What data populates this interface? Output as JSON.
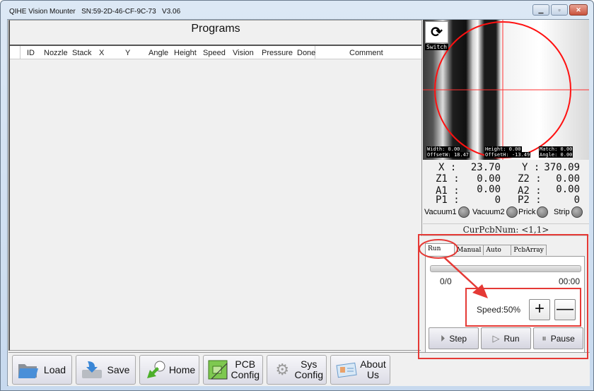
{
  "window": {
    "title": "QIHE Vision Mounter",
    "serial": "SN:59-2D-46-CF-9C-73",
    "version": "V3.06",
    "minimize_icon": "minimize-icon",
    "maximize_icon": "maximize-icon",
    "close_icon": "close-icon"
  },
  "programs": {
    "title": "Programs",
    "columns": [
      "ID",
      "Nozzle",
      "Stack",
      "X",
      "Y",
      "Angle",
      "Height",
      "Speed",
      "Vision",
      "Pressure",
      "Done",
      "Comment"
    ],
    "rows": []
  },
  "camera": {
    "switch_label": "Switch",
    "switch_icon": "refresh-arrows-icon",
    "width_label": "Width:",
    "width_value": "0.00",
    "offsetw_label": "OffsetW:",
    "offsetw_value": "18.47",
    "height_label": "Height:",
    "height_value": "0.00",
    "offseth_label": "OffsetH:",
    "offseth_value": "-13.49",
    "match_label": "Match:",
    "match_value": "0.00",
    "angle_label": "Angle:",
    "angle_value": "0.00",
    "overlay_color": "#ff0000"
  },
  "coords": {
    "x_label": "X :",
    "x_value": "23.70",
    "y_label": "Y :",
    "y_value": "370.09",
    "z1_label": "Z1 :",
    "z1_value": "0.00",
    "z2_label": "Z2 :",
    "z2_value": "0.00",
    "a1_label": "A1 :",
    "a1_value": "0.00",
    "a2_label": "A2 :",
    "a2_value": "0.00",
    "p1_label": "P1 :",
    "p1_value": "0",
    "p2_label": "P2 :",
    "p2_value": "0"
  },
  "indicators": [
    {
      "label": "Vacuum1",
      "state": "off"
    },
    {
      "label": "Vacuum2",
      "state": "off"
    },
    {
      "label": "Prick",
      "state": "off"
    },
    {
      "label": "Strip",
      "state": "off"
    }
  ],
  "cur_pcb": "CurPcbNum: <1,1>",
  "run_panel": {
    "tabs": [
      "Run",
      "Manual",
      "Auto",
      "PcbArray"
    ],
    "active_tab": "Run",
    "progress_fraction": 0,
    "progress_count": "0/0",
    "elapsed": "00:00",
    "speed_label": "Speed:50%",
    "speed_percent": 50,
    "plus_label": "+",
    "minus_label": "—",
    "step_label": "Step",
    "run_label": "Run",
    "pause_label": "Pause"
  },
  "toolbar": {
    "load": "Load",
    "save": "Save",
    "home": "Home",
    "pcb_config_1": "PCB",
    "pcb_config_2": "Config",
    "sys_config_1": "Sys",
    "sys_config_2": "Config",
    "about_1": "About",
    "about_2": "Us"
  },
  "annotation": {
    "color": "#e53935"
  }
}
